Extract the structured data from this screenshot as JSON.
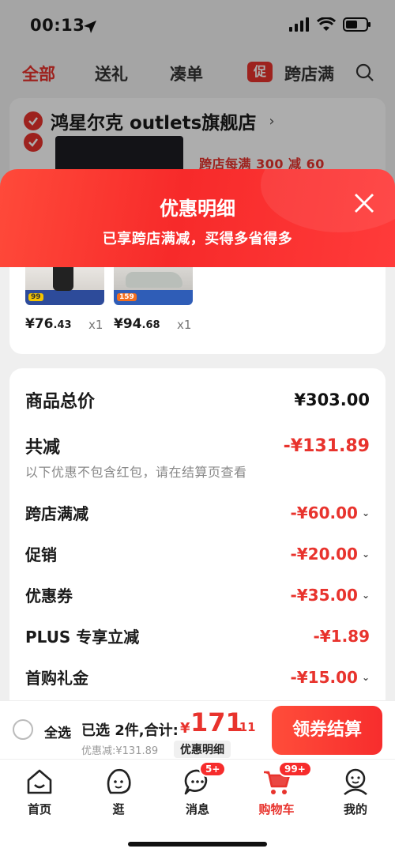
{
  "status_bar": {
    "time": "00:13"
  },
  "top_tabs": {
    "all": "全部",
    "gift": "送礼",
    "bundle": "凑单",
    "promo_tag": "促",
    "cross_store": "跨店满"
  },
  "store": {
    "name": "鸿星尔克 outlets旗舰店",
    "chevron": "›",
    "promo_text": "跨店每满 300 减 60"
  },
  "sheet": {
    "title": "优惠明细",
    "subtitle": "已享跨店满减，买得多省得多"
  },
  "items": [
    {
      "badge": "99",
      "price_int": "¥76",
      "price_dec": ".43",
      "qty": "x1"
    },
    {
      "badge": "159",
      "price_int": "¥94",
      "price_dec": ".68",
      "qty": "x1"
    }
  ],
  "summary": {
    "goods_total_label": "商品总价",
    "goods_total_value": "¥303.00",
    "total_discount_label": "共减",
    "total_discount_value": "-¥131.89",
    "note": "以下优惠不包含红包，请在结算页查看",
    "rows": [
      {
        "label": "跨店满减",
        "value": "-¥60.00"
      },
      {
        "label": "促销",
        "value": "-¥20.00"
      },
      {
        "label": "优惠券",
        "value": "-¥35.00"
      },
      {
        "label": "PLUS 专享立减",
        "value": "-¥1.89"
      },
      {
        "label": "首购礼金",
        "value": "-¥15.00"
      }
    ]
  },
  "checkout": {
    "select_all": "全选",
    "selected_info": "已选 2件,合计:",
    "currency": "¥",
    "total_int": "171",
    "total_dec": ".11",
    "discount_line": "优惠减:¥131.89",
    "detail_chip": "优惠明细",
    "pay_button": "领券结算"
  },
  "tabbar": {
    "home": "首页",
    "browse": "逛",
    "messages": "消息",
    "messages_badge": "5+",
    "cart": "购物车",
    "cart_badge": "99+",
    "mine": "我的"
  },
  "colors": {
    "accent": "#e8332d"
  }
}
